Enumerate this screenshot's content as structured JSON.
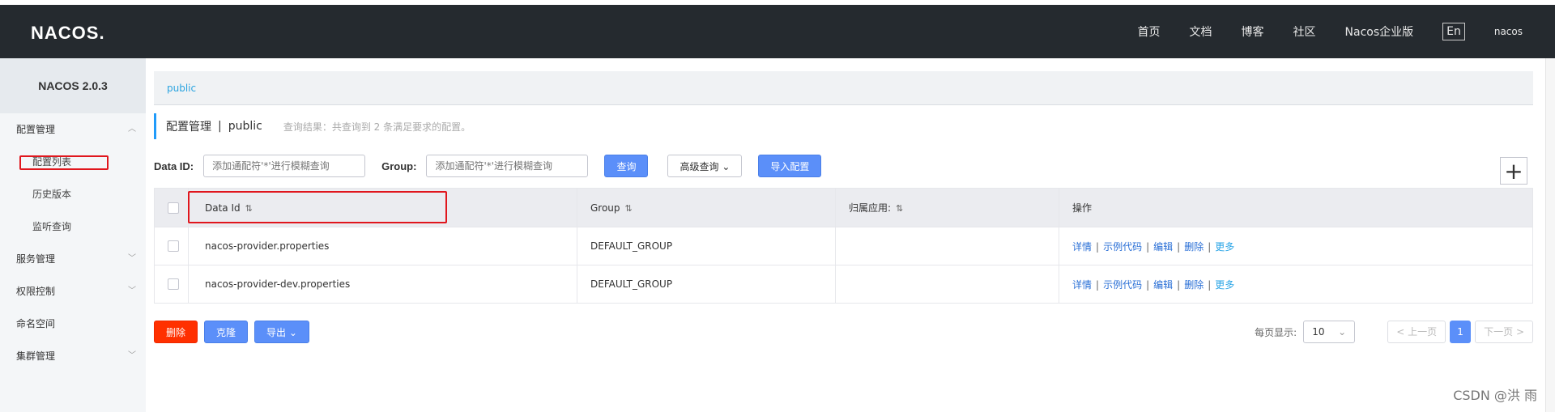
{
  "header": {
    "logo": "NACOS.",
    "nav": [
      "首页",
      "文档",
      "博客",
      "社区",
      "Nacos企业版"
    ],
    "lang": "En",
    "user": "nacos"
  },
  "sidebar": {
    "title": "NACOS 2.0.3",
    "items": [
      {
        "label": "配置管理",
        "arrow": "︿"
      },
      {
        "label": "配置列表"
      },
      {
        "label": "历史版本"
      },
      {
        "label": "监听查询"
      },
      {
        "label": "服务管理",
        "arrow": "﹀"
      },
      {
        "label": "权限控制",
        "arrow": "﹀"
      },
      {
        "label": "命名空间"
      },
      {
        "label": "集群管理",
        "arrow": "﹀"
      }
    ]
  },
  "main": {
    "namespace_tab": "public",
    "page_title": "配置管理",
    "page_sep": "|",
    "page_namespace": "public",
    "hint": "查询结果：共查询到 2 条满足要求的配置。",
    "search": {
      "dataid_label": "Data ID:",
      "dataid_placeholder": "添加通配符'*'进行模糊查询",
      "group_label": "Group:",
      "group_placeholder": "添加通配符'*'进行模糊查询",
      "query_btn": "查询",
      "advanced_btn": "高级查询",
      "import_btn": "导入配置"
    },
    "table": {
      "columns": [
        "Data Id",
        "Group",
        "归属应用:",
        "操作"
      ],
      "rows": [
        {
          "dataid": "nacos-provider.properties",
          "group": "DEFAULT_GROUP",
          "app": ""
        },
        {
          "dataid": "nacos-provider-dev.properties",
          "group": "DEFAULT_GROUP",
          "app": ""
        }
      ],
      "ops": [
        "详情",
        "示例代码",
        "编辑",
        "删除",
        "更多"
      ]
    },
    "bottom": {
      "delete_btn": "删除",
      "clone_btn": "克隆",
      "export_btn": "导出",
      "per_page_label": "每页显示:",
      "per_page_value": "10",
      "prev": "上一页",
      "next": "下一页",
      "current_page": "1"
    }
  },
  "watermark": "CSDN @洪 雨",
  "colors": {
    "header_bg": "#252a2f",
    "primary": "#5b8ff9",
    "danger": "#ff3000",
    "link": "#2a6fd6",
    "highlight": "#e0161d"
  }
}
